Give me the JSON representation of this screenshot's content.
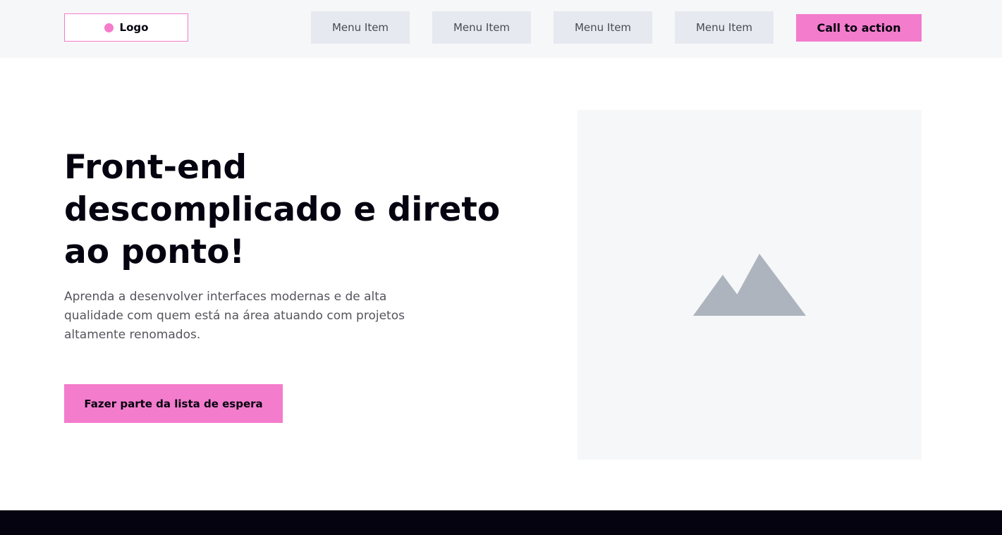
{
  "header": {
    "logo_label": "Logo",
    "menu_items": [
      "Menu Item",
      "Menu Item",
      "Menu Item",
      "Menu Item"
    ],
    "cta_label": "Call to action"
  },
  "hero": {
    "title": "Front-end descomplicado e direto ao ponto!",
    "description": "Aprenda a desenvolver interfaces modernas e de alta qualidade com quem está na área atuando com projetos altamente renomados.",
    "button_label": "Fazer parte da lista de espera",
    "image_icon": "mountain-image-icon"
  },
  "colors": {
    "accent": "#f47ccc",
    "dark": "#05030f",
    "light_bg": "#f6f7f9",
    "menu_bg": "#e6e9ef",
    "placeholder_icon": "#adb4be"
  }
}
